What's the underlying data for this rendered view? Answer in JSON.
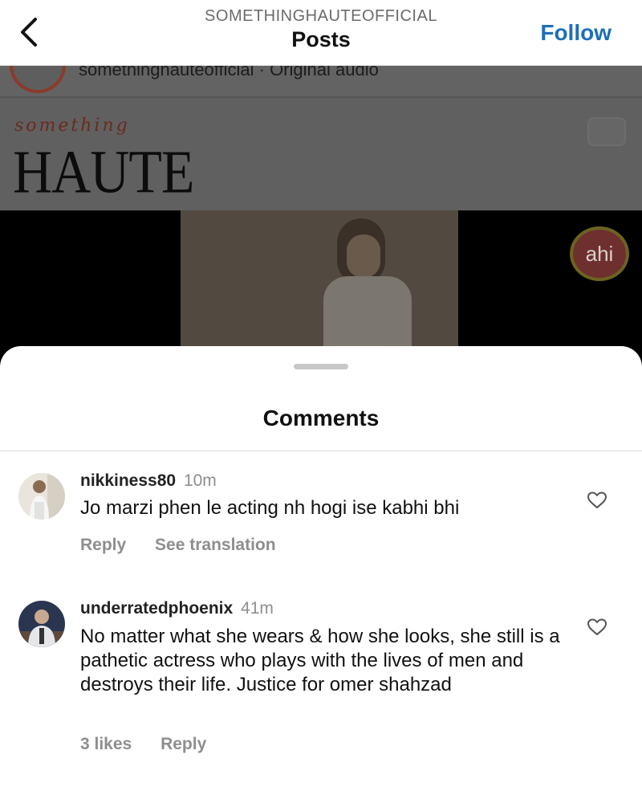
{
  "nav": {
    "account": "SOMETHINGHAUTEOFFICIAL",
    "title": "Posts",
    "follow_label": "Follow"
  },
  "post": {
    "meta_text": "somethinghauteofficial · Original audio",
    "brand_script": "something",
    "brand_main": "HAUTE",
    "badge_text": "ahi"
  },
  "sheet": {
    "title": "Comments"
  },
  "comments": [
    {
      "username": "nikkiness80",
      "time": "10m",
      "text": "Jo marzi phen le acting nh hogi ise kabhi bhi",
      "reply_label": "Reply",
      "translate_label": "See translation"
    },
    {
      "username": "underratedphoenix",
      "time": "41m",
      "text": "No matter what she wears & how she looks, she still is a pathetic actress who plays with the lives of men and destroys their life. Justice for omer shahzad",
      "likes_label": "3 likes",
      "reply_label": "Reply"
    }
  ],
  "colors": {
    "accent": "#1d6fb8",
    "muted": "#8e8e8e"
  }
}
